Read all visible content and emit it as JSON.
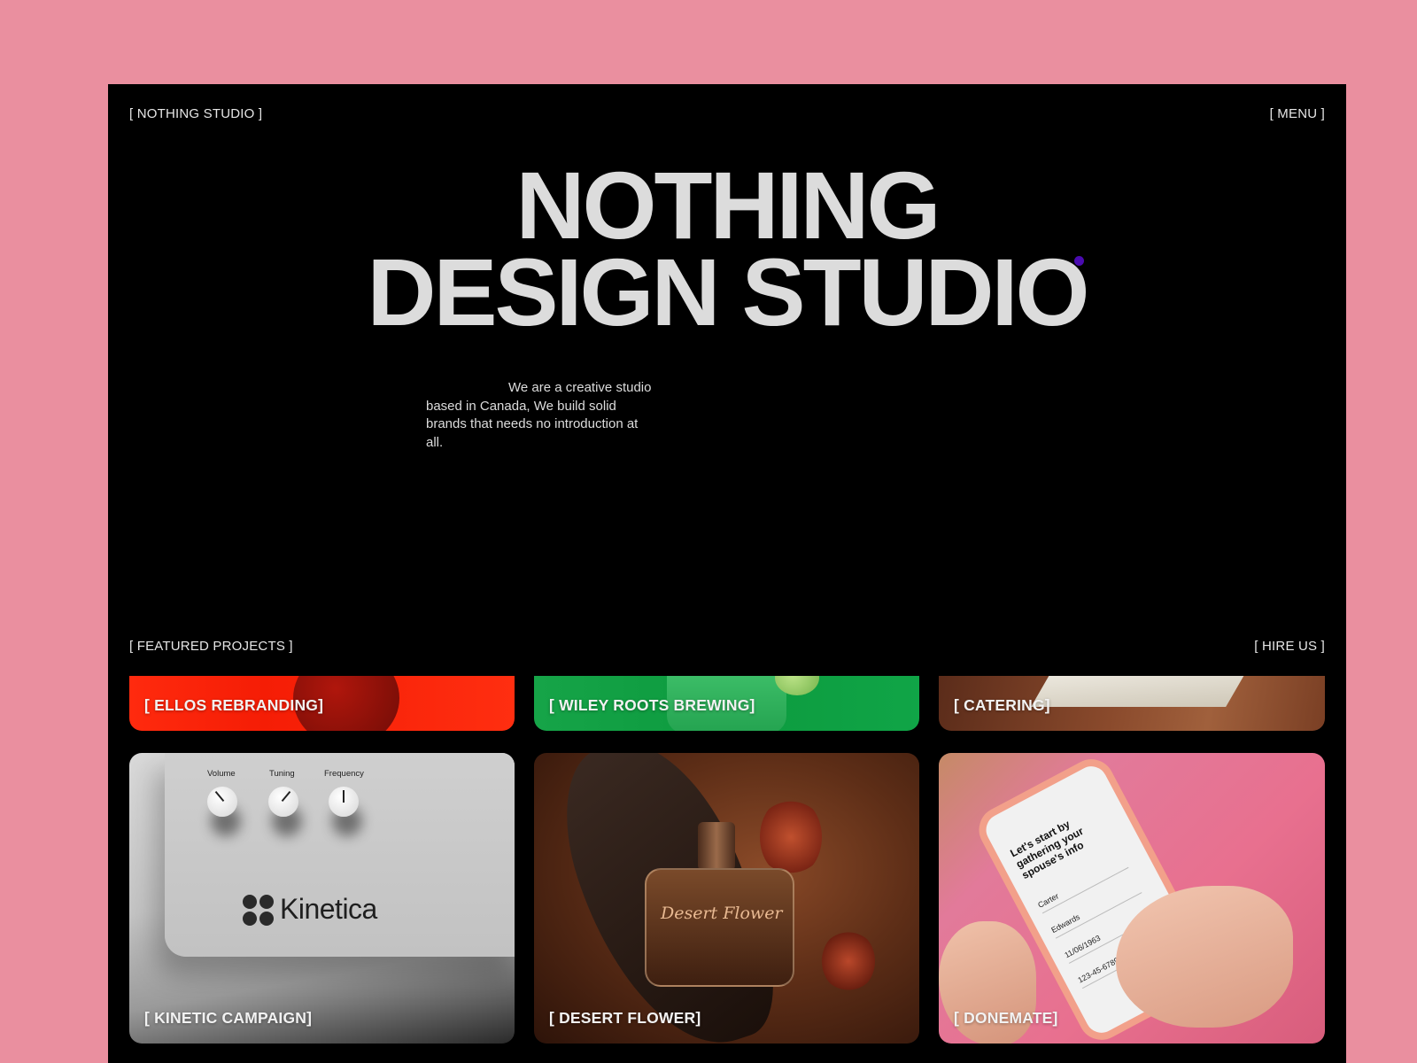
{
  "nav": {
    "brand": "[ NOTHING STUDIO ]",
    "menu": "[ MENU ]"
  },
  "hero": {
    "line1": "NOTHING",
    "line2": "DESIGN STUDIO"
  },
  "intro": "We are a creative studio based in Canada, We build solid brands that needs no introduction at all.",
  "featured": {
    "label": "[ FEATURED PROJECTS ]",
    "hire": "[ HIRE US ]"
  },
  "projects": [
    {
      "label": "[ ELLOS REBRANDING]"
    },
    {
      "label": "[ WILEY ROOTS BREWING]"
    },
    {
      "label": "[ CATERING]"
    },
    {
      "label": "[ KINETIC CAMPAIGN]"
    },
    {
      "label": "[ DESERT FLOWER]"
    },
    {
      "label": "[ DONEMATE]"
    }
  ],
  "kinetica": {
    "brand": "Kinetica",
    "knobs": [
      "Volume",
      "Tuning",
      "Frequency"
    ]
  },
  "desert": {
    "script": "Desert Flower"
  },
  "donemate": {
    "screen_title": "Let's start by gathering your spouse's info",
    "fields": [
      "Carter",
      "Edwards",
      "11/06/1963",
      "123-45-6789"
    ]
  },
  "colors": {
    "page_bg": "#ea8f9f",
    "frame_bg": "#000000",
    "hero_text": "#dcdcdc",
    "cursor": "#4a0bb0"
  }
}
